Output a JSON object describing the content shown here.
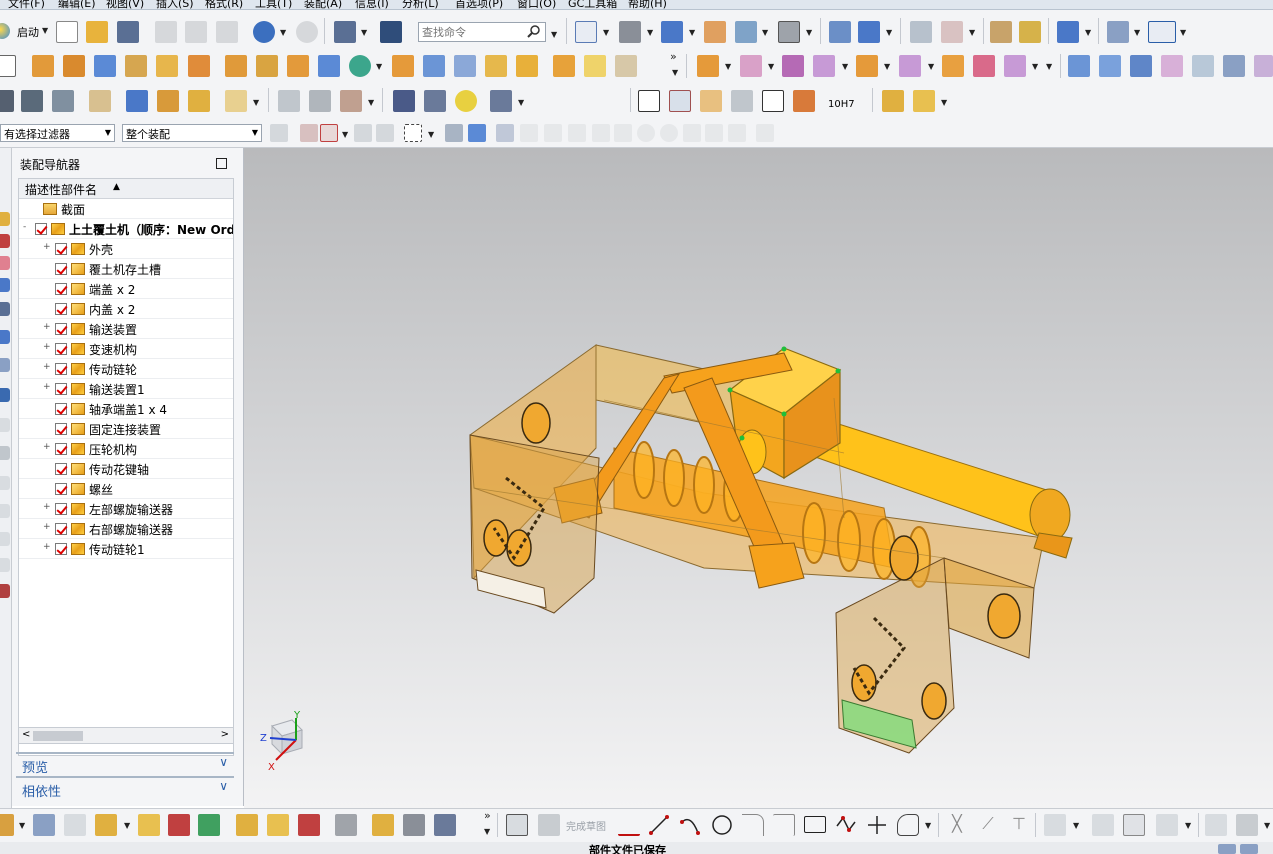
{
  "menu": {
    "items": [
      "文件(F)",
      "编辑(E)",
      "视图(V)",
      "插入(S)",
      "格式(R)",
      "工具(T)",
      "装配(A)",
      "信息(I)",
      "分析(L)",
      "首选项(P)",
      "窗口(O)",
      "GC工具箱",
      "帮助(H)"
    ]
  },
  "toolbar": {
    "start_label": "启动",
    "command_search_placeholder": "查找命令",
    "selection_filter_value": "有选择过滤器",
    "assembly_scope_value": "整个装配",
    "fit_label": "10H7"
  },
  "navigator": {
    "title": "装配导航器",
    "column_header": "描述性部件名",
    "rows": [
      {
        "label": "截面"
      },
      {
        "label": "上土覆土机（顺序：New Ord"
      },
      {
        "label": "外壳"
      },
      {
        "label": "覆土机存土槽"
      },
      {
        "label": "端盖 x 2"
      },
      {
        "label": "内盖 x 2"
      },
      {
        "label": "输送装置"
      },
      {
        "label": "变速机构"
      },
      {
        "label": "传动链轮"
      },
      {
        "label": "输送装置1"
      },
      {
        "label": "轴承端盖1 x 4"
      },
      {
        "label": "固定连接装置"
      },
      {
        "label": "压轮机构"
      },
      {
        "label": "传动花键轴"
      },
      {
        "label": "螺丝"
      },
      {
        "label": "左部螺旋输送器"
      },
      {
        "label": "右部螺旋输送器"
      },
      {
        "label": "传动链轮1"
      }
    ],
    "sections": [
      {
        "label": "预览"
      },
      {
        "label": "相依性"
      }
    ]
  },
  "bottom_toolbar": {
    "finish_sketch_label": "完成草图"
  },
  "status": {
    "message": "部件文件已保存"
  },
  "triad": {
    "x": "X",
    "y": "Y",
    "z": "Z"
  },
  "colors": {
    "accent": "#2a5ea8",
    "model_orange": "#f2a51f",
    "model_gold": "#ffc21a",
    "check_red": "#d00000"
  }
}
